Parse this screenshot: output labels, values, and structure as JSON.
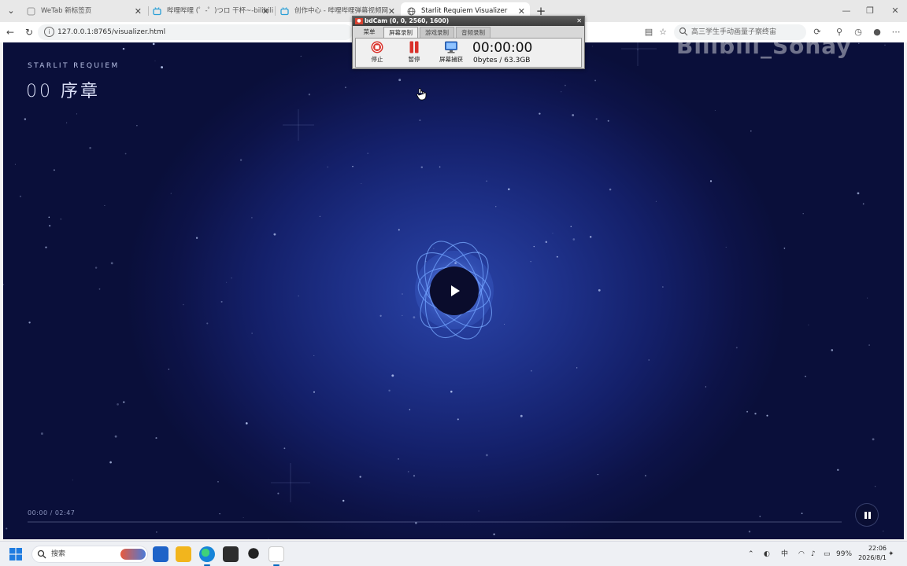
{
  "browser": {
    "tabs": [
      {
        "label": "WeTab 新标签页",
        "active": false
      },
      {
        "label": "哔哩哔哩 (゜-゜)つロ 干杯~-bilibili",
        "active": false
      },
      {
        "label": "创作中心 - 哔哩哔哩弹幕视频网",
        "active": false
      },
      {
        "label": "Starlit Requiem Visualizer",
        "active": true
      }
    ],
    "new_tab_label": "+",
    "url": "127.0.0.1:8765/visualizer.html",
    "search_placeholder": "高三学生手动画量子察终宙"
  },
  "visualizer": {
    "brand": "STARLIT REQUIEM",
    "chapter": "00 序章",
    "watermark": "Bilibili_Sonay",
    "time_current": "00:00",
    "time_total": "02:47",
    "time_display": "00:00 / 02:47",
    "progress": 0.0,
    "accent_color": "#2a44a8"
  },
  "bdcam": {
    "title": "bdCam (0, 0, 2560, 1600)",
    "tabs": [
      "菜单",
      "屏幕录制",
      "游戏录制",
      "音频录制"
    ],
    "selected_tab": "屏幕录制",
    "buttons": [
      {
        "label": "停止",
        "icon": "stop-icon"
      },
      {
        "label": "暂停",
        "icon": "pause-icon"
      },
      {
        "label": "屏幕捕获",
        "icon": "monitor-icon"
      }
    ],
    "timer": "00:00:00",
    "size": "0bytes / 63.3GB"
  },
  "taskbar": {
    "search_label": "搜索",
    "ime": "中",
    "battery": "99%",
    "time": "22:06",
    "date": "2026/8/1"
  }
}
